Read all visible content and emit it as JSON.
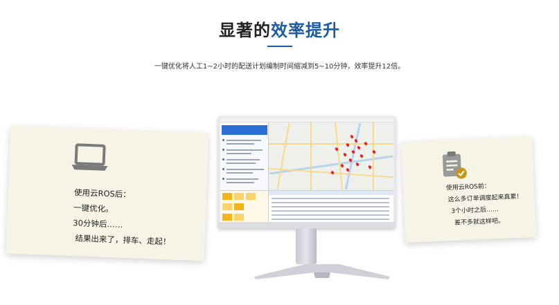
{
  "header": {
    "title_dark": "显著的",
    "title_highlight": "效率提升",
    "subtitle": "一键优化将人工1~2小时的配送计划编制时间缩减到5~10分钟，效率提升12倍。"
  },
  "left_note": {
    "icon": "laptop-icon",
    "lines": [
      "使用云ROS后：",
      "一键优化。",
      "30分钟后……",
      "结果出来了，排车、走起！"
    ]
  },
  "right_note": {
    "icon": "clipboard-check-icon",
    "lines": [
      "使用云ROS前：",
      "这么多订单调度起来真累！",
      "3个小时之后……",
      "差不多就这样吧。"
    ]
  },
  "monitor": {
    "icon": "route-map-screen"
  },
  "colors": {
    "accent": "#1b5aa5",
    "note_bg": "#f5f4e6",
    "pin": "#e0242b",
    "check": "#c8961c"
  }
}
